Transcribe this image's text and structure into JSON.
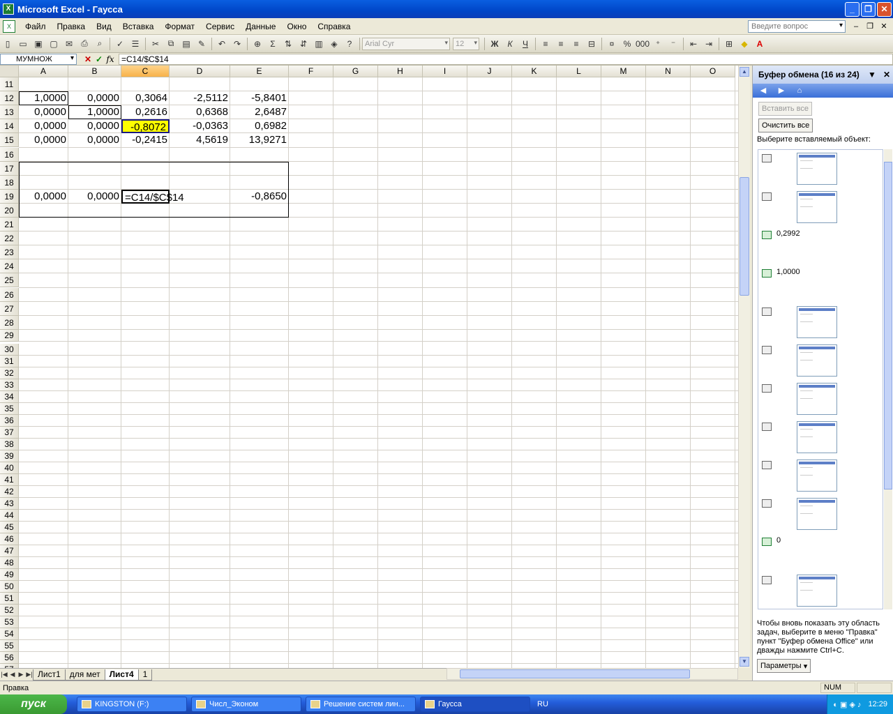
{
  "window": {
    "title": "Microsoft Excel - Гаусса"
  },
  "menu": [
    "Файл",
    "Правка",
    "Вид",
    "Вставка",
    "Формат",
    "Сервис",
    "Данные",
    "Окно",
    "Справка"
  ],
  "help_placeholder": "Введите вопрос",
  "font_name": "Arial Cyr",
  "font_size": "12",
  "formula": {
    "namebox": "МУМНОЖ",
    "content": "=C14/$C$14"
  },
  "columns": [
    "A",
    "B",
    "C",
    "D",
    "E",
    "F",
    "G",
    "H",
    "I",
    "J",
    "K",
    "L",
    "M",
    "N",
    "O"
  ],
  "rows_first": 11,
  "rows_last": 57,
  "cells": {
    "A12": "1,0000",
    "B12": "0,0000",
    "C12": "0,3064",
    "D12": "-2,5112",
    "E12": "-5,8401",
    "A13": "0,0000",
    "B13": "1,0000",
    "C13": "0,2616",
    "D13": "0,6368",
    "E13": "2,6487",
    "A14": "0,0000",
    "B14": "0,0000",
    "C14": "-0,8072",
    "D14": "-0,0363",
    "E14": "0,6982",
    "A15": "0,0000",
    "B15": "0,0000",
    "C15": "-0,2415",
    "D15": "4,5619",
    "E15": "13,9271",
    "A19": "0,0000",
    "B19": "0,0000",
    "C19": "=C14/$C$14",
    "E19": "-0,8650"
  },
  "sheet_tabs": [
    "Лист1",
    "для мет",
    "Лист4",
    "1"
  ],
  "active_tab": "Лист4",
  "taskpane": {
    "title": "Буфер обмена (16 из 24)",
    "paste_all": "Вставить все",
    "clear_all": "Очистить все",
    "choose_label": "Выберите вставляемый объект:",
    "items": [
      {
        "kind": "image"
      },
      {
        "kind": "image"
      },
      {
        "kind": "text",
        "text": "0,2992"
      },
      {
        "kind": "text",
        "text": "1,0000"
      },
      {
        "kind": "image"
      },
      {
        "kind": "image"
      },
      {
        "kind": "image"
      },
      {
        "kind": "image"
      },
      {
        "kind": "image"
      },
      {
        "kind": "image"
      },
      {
        "kind": "text",
        "text": "0"
      },
      {
        "kind": "image"
      }
    ],
    "footer": "Чтобы вновь показать эту область задач, выберите в меню \"Правка\" пункт \"Буфер обмена Office\" или дважды нажмите Ctrl+C.",
    "options": "Параметры"
  },
  "status": {
    "mode": "Правка",
    "num": "NUM"
  },
  "taskbar": {
    "start": "пуск",
    "buttons": [
      "KINGSTON (F:)",
      "Числ_Эконом",
      "Решение систем лин...",
      "Гаусса"
    ],
    "lang": "RU",
    "time": "12:29"
  },
  "colors": {
    "selected_cell_fill": "#ffff00",
    "xp_blue": "#0046c8"
  }
}
